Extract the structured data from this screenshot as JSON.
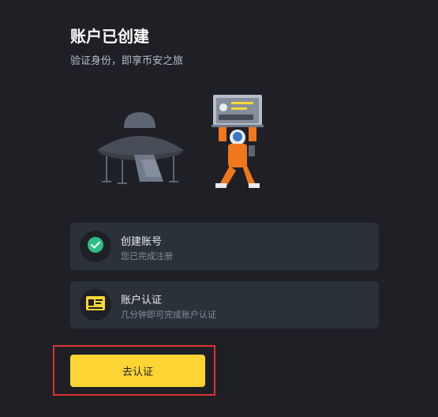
{
  "header": {
    "title": "账户已创建",
    "subtitle": "验证身份，即享币安之旅"
  },
  "steps": [
    {
      "title": "创建账号",
      "desc": "您已完成注册",
      "icon": "check-circle-icon",
      "status": "done"
    },
    {
      "title": "账户认证",
      "desc": "几分钟即可完成账户认证",
      "icon": "id-card-icon",
      "status": "pending"
    }
  ],
  "cta": {
    "label": "去认证"
  },
  "colors": {
    "background": "#1e2026",
    "card": "#2b3139",
    "accent": "#fcd535",
    "success": "#2ebd85",
    "highlight": "#e03131"
  }
}
